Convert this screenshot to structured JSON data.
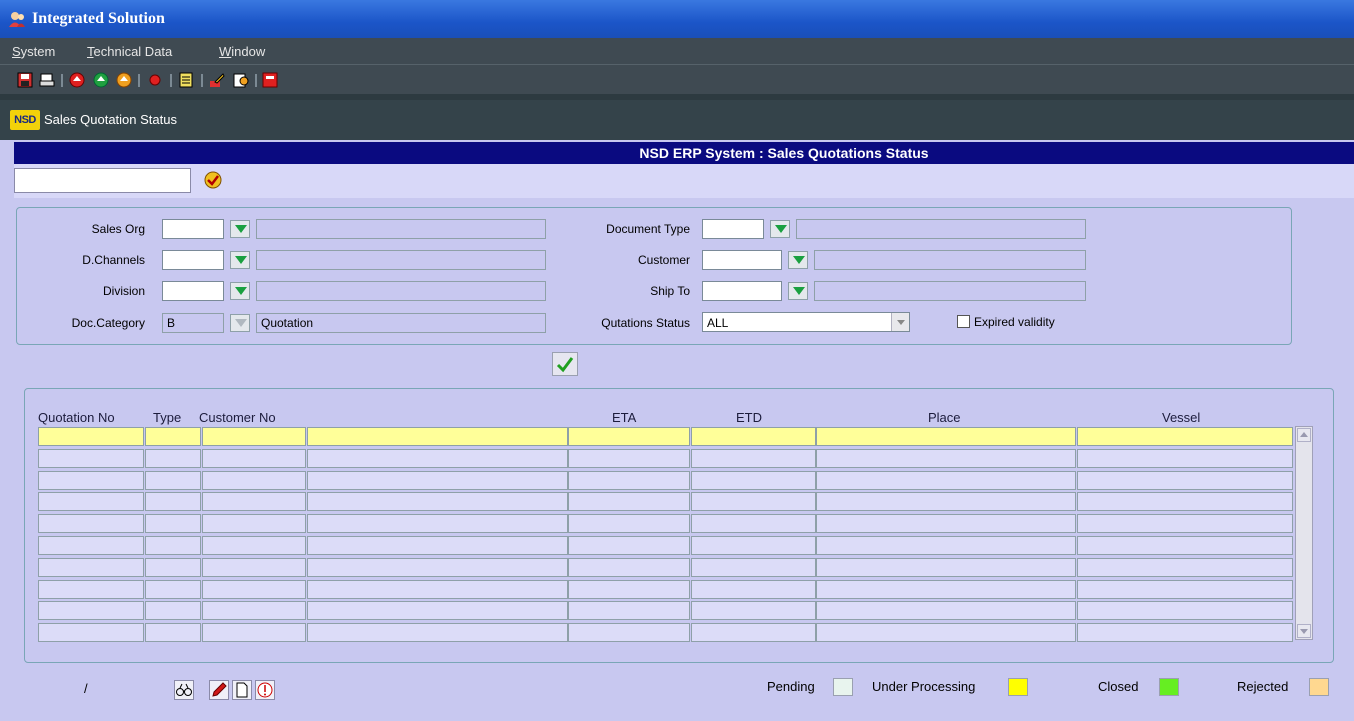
{
  "window": {
    "title": "Integrated Solution"
  },
  "menu": [
    "System",
    "Technical Data",
    "Window"
  ],
  "toolbar_icons": [
    "save-icon",
    "print-icon",
    "record-first-icon",
    "record-prev-icon",
    "record-next-icon",
    "stop-icon",
    "list-icon",
    "edit-icon",
    "query-icon",
    "exit-icon"
  ],
  "form": {
    "logo": "NSD",
    "title": "Sales Quotation Status",
    "banner": "NSD ERP System : Sales Quotations Status"
  },
  "params": {
    "sales_org": {
      "label": "Sales Org",
      "value": ""
    },
    "d_channels": {
      "label": "D.Channels",
      "value": ""
    },
    "division": {
      "label": "Division",
      "value": ""
    },
    "doc_category": {
      "label": "Doc.Category",
      "code": "B",
      "description": "Quotation"
    },
    "document_type": {
      "label": "Document Type",
      "value": ""
    },
    "customer": {
      "label": "Customer",
      "value": ""
    },
    "ship_to": {
      "label": "Ship To",
      "value": ""
    },
    "quotations_status": {
      "label": "Qutations Status",
      "value": "ALL"
    },
    "expired_validity": {
      "label": "Expired validity",
      "checked": false
    }
  },
  "grid": {
    "columns": [
      "Quotation No",
      "Type",
      "Customer No",
      "ETA",
      "ETD",
      "Place",
      "Vessel"
    ],
    "row_count": 10
  },
  "footer": {
    "record_indicator": "/",
    "legend": [
      {
        "label": "Pending",
        "color": "#e8f4ee"
      },
      {
        "label": "Under Processing",
        "color": "#ffff00"
      },
      {
        "label": "Closed",
        "color": "#66ee22"
      },
      {
        "label": "Rejected",
        "color": "#ffd890"
      }
    ]
  }
}
